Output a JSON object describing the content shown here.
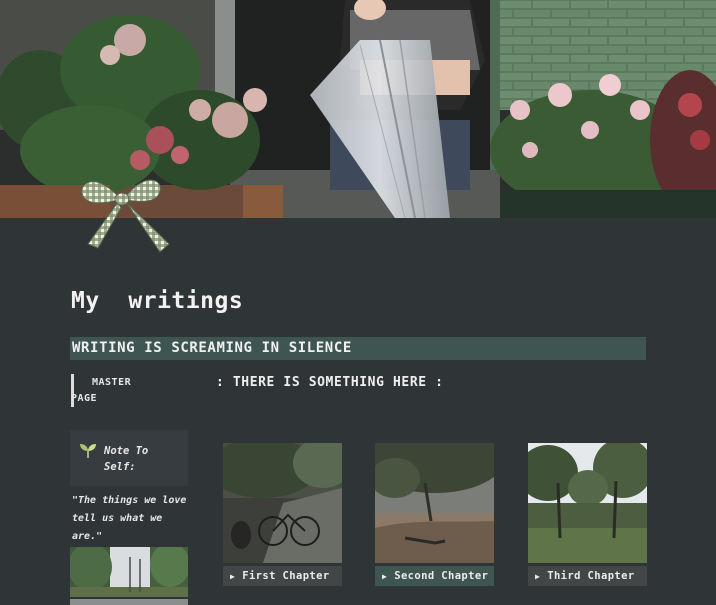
{
  "page": {
    "title": "My  writings",
    "banner": "WRITING IS SCREAMING IN SILENCE",
    "master_page_label": "MASTER PAGE",
    "subheading": ": THERE IS SOMETHING HERE :"
  },
  "callout": {
    "icon": "leaf-sprout-icon",
    "text": "Note To Self:",
    "quote": "\"The things we love tell us what we are.\""
  },
  "chapters": [
    {
      "label": "First Chapter",
      "icon": "triangle-right-icon"
    },
    {
      "label": "Second Chapter",
      "icon": "triangle-right-icon"
    },
    {
      "label": "Third Chapter",
      "icon": "triangle-right-icon"
    }
  ],
  "colors": {
    "background": "#2f3437",
    "banner": "#3e5552",
    "chapter_label": "#434647",
    "callout": "#363c3f"
  }
}
